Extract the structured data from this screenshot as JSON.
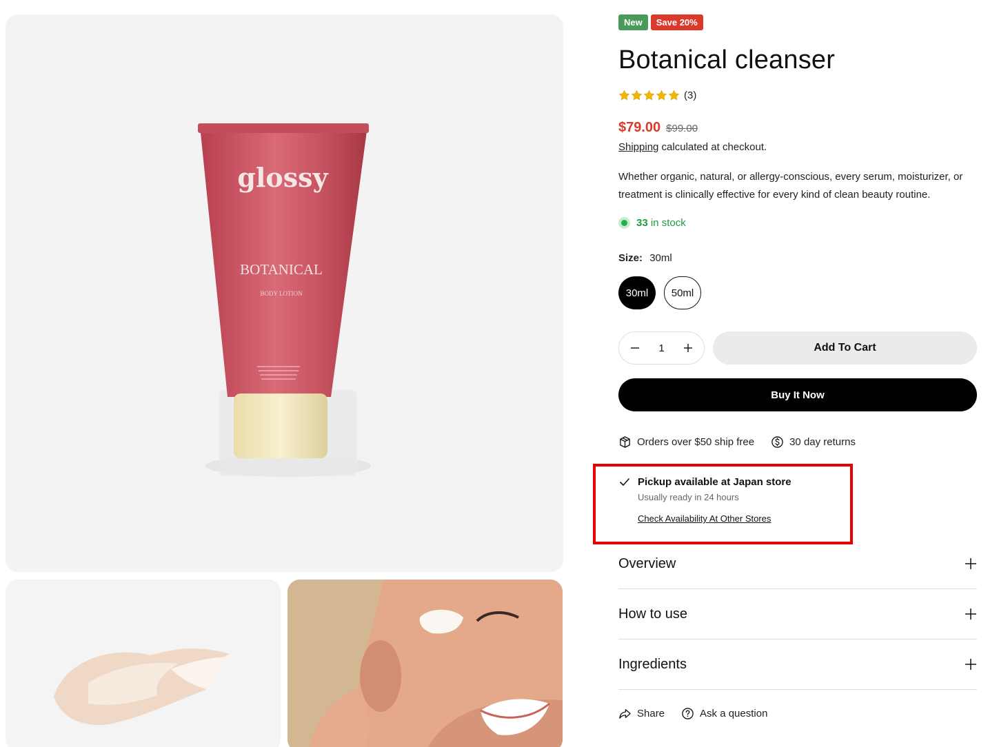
{
  "product": {
    "badges": {
      "new": "New",
      "save": "Save 20%"
    },
    "title": "Botanical cleanser",
    "rating": {
      "stars": 5,
      "count": "(3)"
    },
    "price": "$79.00",
    "compare_price": "$99.00",
    "shipping": {
      "link": "Shipping",
      "text": " calculated at checkout."
    },
    "description": "Whether organic, natural, or allergy-conscious, every serum, moisturizer, or treatment is clinically effective for every kind of clean beauty routine.",
    "stock": {
      "count": "33",
      "text": " in stock"
    },
    "size": {
      "label": "Size:",
      "selected": "30ml",
      "options": [
        "30ml",
        "50ml"
      ]
    },
    "quantity": "1",
    "add_to_cart": "Add To Cart",
    "buy_now": "Buy It Now",
    "perks": [
      "Orders over $50 ship free",
      "30 day returns"
    ],
    "pickup": {
      "title": "Pickup available at Japan store",
      "subtitle": "Usually ready in 24 hours",
      "link": "Check Availability At Other Stores"
    },
    "accordions": [
      "Overview",
      "How to use",
      "Ingredients"
    ],
    "actions": {
      "share": "Share",
      "ask": "Ask a question"
    }
  },
  "images": {
    "main": {
      "brand": "glossy",
      "product_line": "BOTANICAL",
      "product_type": "BODY LOTION"
    }
  },
  "colors": {
    "accent_red": "#d93a2b",
    "stock_green": "#1f9c3d",
    "badge_green": "#4a9b5b",
    "tube_pink": "#c9505e",
    "cap_cream": "#f4ebc4"
  }
}
